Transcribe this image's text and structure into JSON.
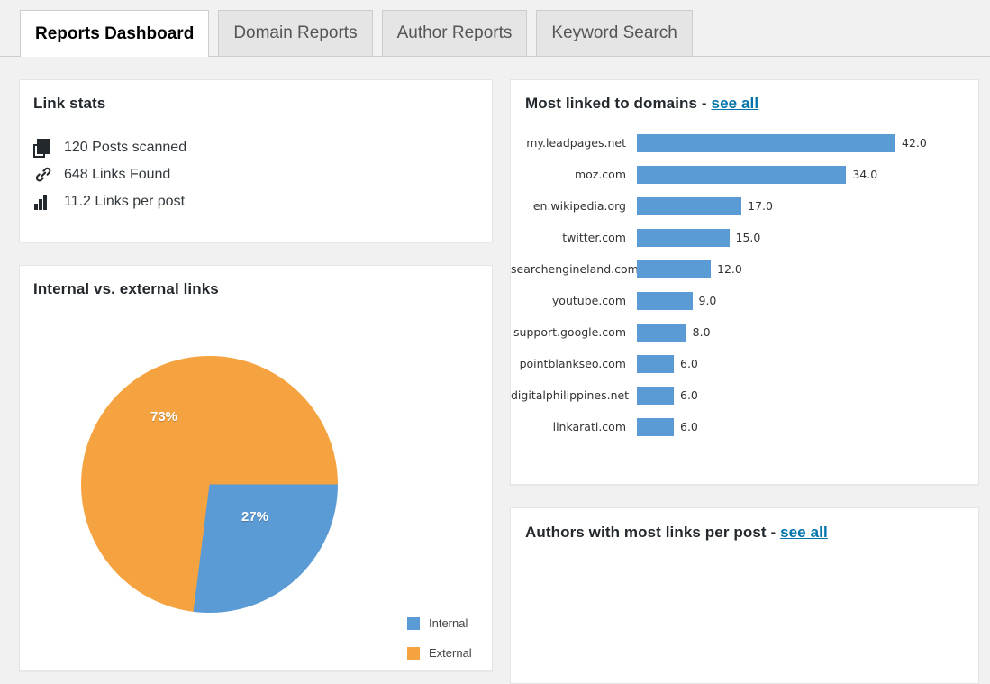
{
  "tabs": [
    {
      "label": "Reports Dashboard",
      "active": true
    },
    {
      "label": "Domain Reports",
      "active": false
    },
    {
      "label": "Author Reports",
      "active": false
    },
    {
      "label": "Keyword Search",
      "active": false
    }
  ],
  "link_stats": {
    "title": "Link stats",
    "rows": [
      {
        "icon": "posts-icon",
        "text": "120 Posts scanned",
        "value": 120,
        "unit": "Posts scanned"
      },
      {
        "icon": "link-icon",
        "text": "648 Links Found",
        "value": 648,
        "unit": "Links Found"
      },
      {
        "icon": "bar-chart-icon",
        "text": "11.2 Links per post",
        "value": 11.2,
        "unit": "Links per post"
      }
    ]
  },
  "pie_card": {
    "title": "Internal vs. external links"
  },
  "domains_card": {
    "title_prefix": "Most linked to domains - ",
    "see_all_label": "see all"
  },
  "authors_card": {
    "title_prefix": "Authors with most links per post - ",
    "see_all_label": "see all"
  },
  "colors": {
    "blue": "#5b9bd5",
    "orange": "#f5a340",
    "link": "#0073aa",
    "page_bg": "#f1f1f1",
    "card_bg": "#ffffff",
    "card_border": "#e5e5e5",
    "text": "#23282d"
  },
  "chart_data": [
    {
      "type": "bar",
      "title": "Most linked to domains",
      "orientation": "horizontal",
      "xlabel": "",
      "ylabel": "",
      "grid": false,
      "legend": "none",
      "xlim": [
        0,
        42
      ],
      "categories": [
        "my.leadpages.net",
        "moz.com",
        "en.wikipedia.org",
        "twitter.com",
        "searchengineland.com",
        "youtube.com",
        "support.google.com",
        "pointblankseo.com",
        "digitalphilippines.net",
        "linkarati.com"
      ],
      "values": [
        42,
        34,
        17,
        15,
        12,
        9,
        8,
        6,
        6,
        6
      ],
      "value_labels": [
        "42.0",
        "34.0",
        "17.0",
        "15.0",
        "12.0",
        "9.0",
        "8.0",
        "6.0",
        "6.0",
        "6.0"
      ]
    },
    {
      "type": "pie",
      "title": "Internal vs. external links",
      "legend": "right",
      "labels": [
        "Internal",
        "External"
      ],
      "values": [
        27,
        73
      ],
      "value_labels": [
        "27%",
        "73%"
      ],
      "colors": [
        "#5b9bd5",
        "#f5a340"
      ],
      "start_angle_deg": 0,
      "direction": "clockwise"
    }
  ]
}
